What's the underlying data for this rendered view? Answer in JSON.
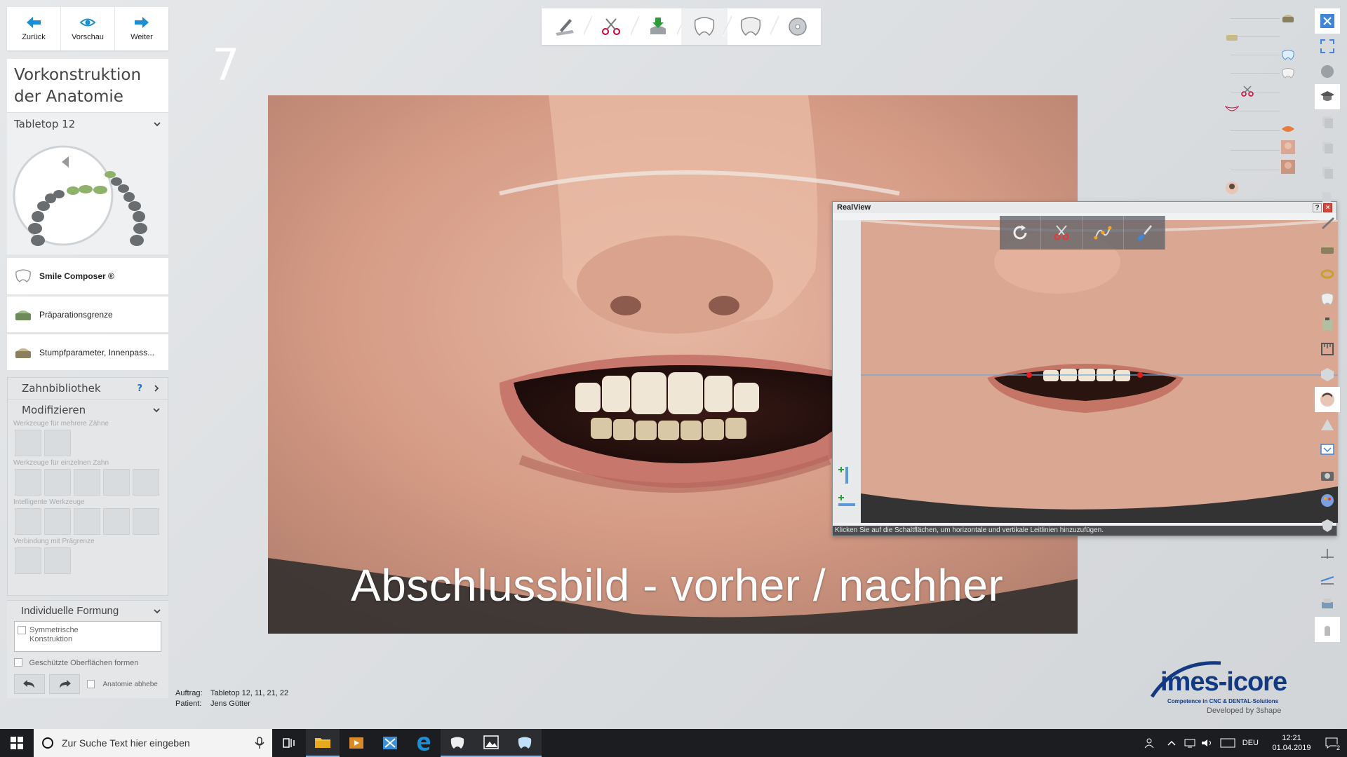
{
  "nav": {
    "back": "Zurück",
    "preview": "Vorschau",
    "next": "Weiter"
  },
  "step_number": "7",
  "panel": {
    "title_line1": "Vorkonstruktion",
    "title_line2": "der Anatomie",
    "tabletop": "Tabletop 12"
  },
  "workflow": [
    {
      "label": "Smile Composer ®",
      "icon": "tooth-icon"
    },
    {
      "label": "Präparationsgrenze",
      "icon": "margin-icon"
    },
    {
      "label": "Stumpfparameter, Innenpass...",
      "icon": "die-icon"
    }
  ],
  "tools": {
    "library": "Zahnbibliothek",
    "library_help": "?",
    "modify": "Modifizieren",
    "sec_multi": "Werkzeuge für mehrere Zähne",
    "sec_single": "Werkzeuge für einzelnen Zahn",
    "sec_smart": "Intelligente Werkzeuge",
    "sec_connect": "Verbindung mit Prägrenze",
    "individual": "Individuelle Formung",
    "symmetric": "Symmetrische Konstruktion",
    "protected": "Geschützte Oberflächen formen",
    "anatomy": "Anatomie abhebe"
  },
  "caption": "Abschlussbild - vorher / nachher",
  "realview": {
    "title": "RealView",
    "status": "Klicken Sie auf die Schaltflächen, um horizontale und vertikale Leitlinien hinzuzufügen."
  },
  "info": {
    "order_label": "Auftrag:",
    "order_value": "Tabletop 12, 11, 21, 22",
    "patient_label": "Patient:",
    "patient_value": "Jens Gütter"
  },
  "logo": {
    "name": "imes-icore",
    "tagline": "Competence in CNC & DENTAL-Solutions",
    "dev": "Developed by 3shape"
  },
  "taskbar": {
    "search_placeholder": "Zur Suche Text hier eingeben",
    "lang": "DEU",
    "time": "12:21",
    "date": "01.04.2019",
    "notifications": "2"
  },
  "colors": {
    "accent": "#1a8fd6",
    "taskbar": "#1c1d20",
    "close": "#d24a3a"
  }
}
